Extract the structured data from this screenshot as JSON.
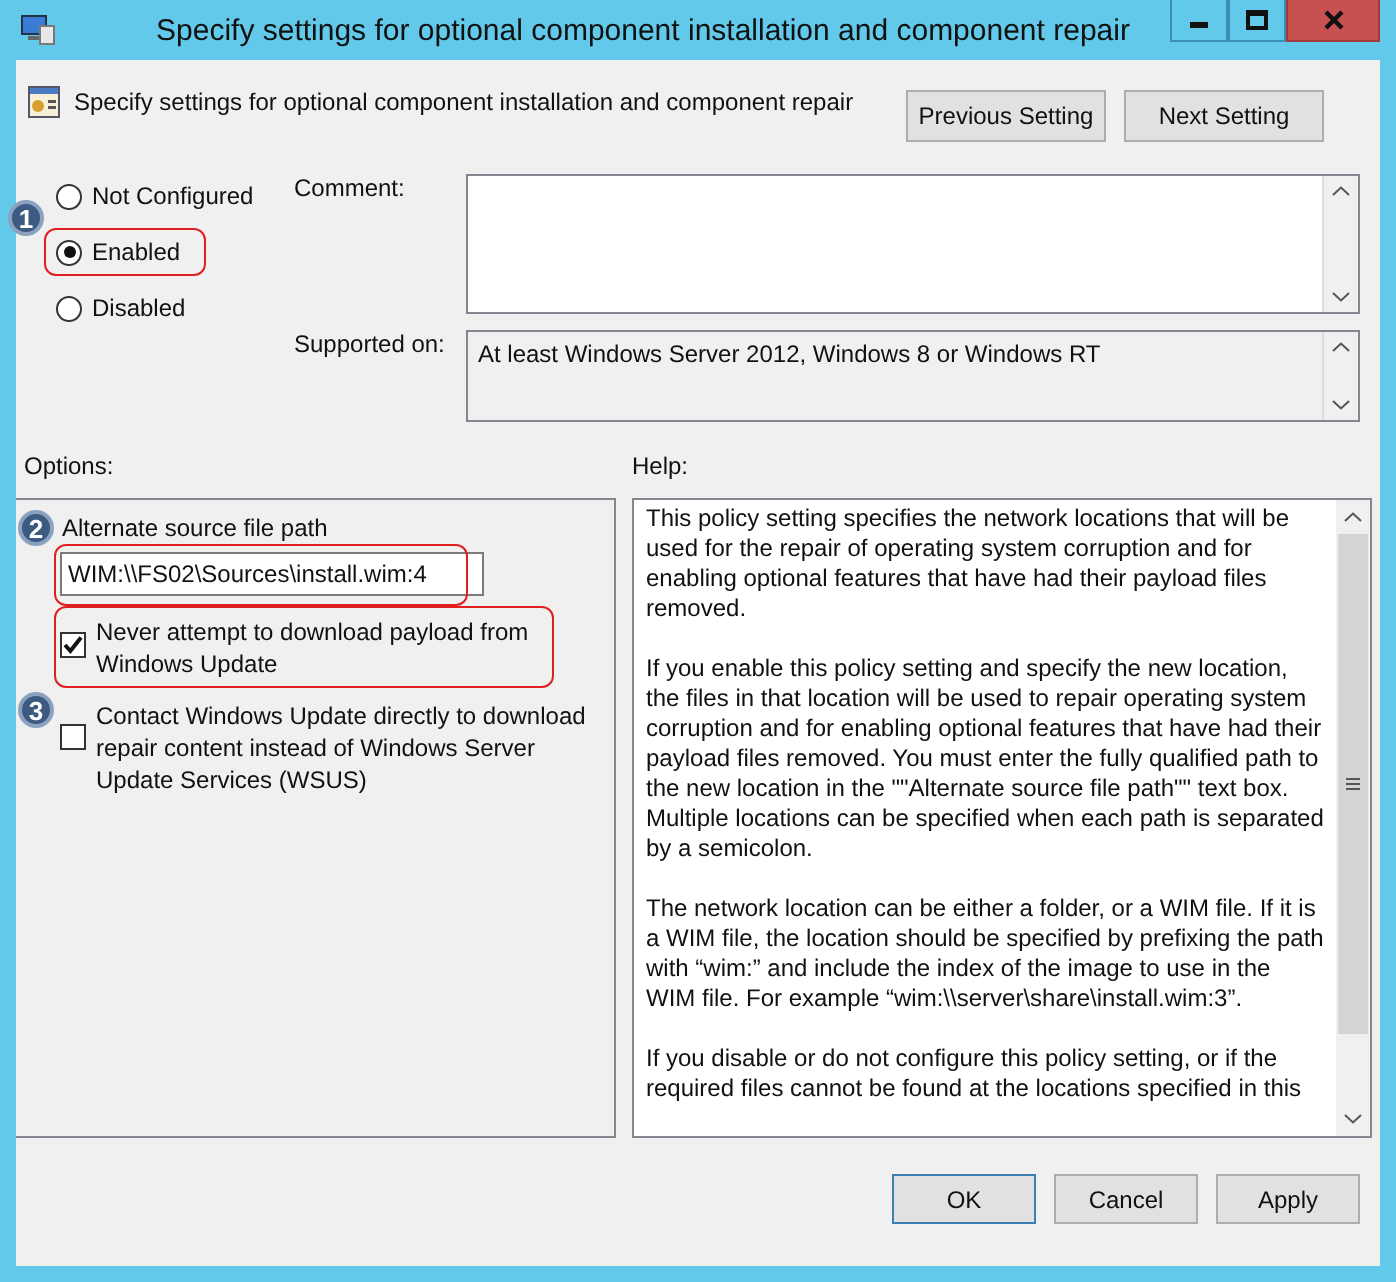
{
  "window": {
    "title": "Specify settings for optional component installation and component repair"
  },
  "header": {
    "title": "Specify settings for optional component installation and component repair",
    "buttons": [
      "Previous Setting",
      "Next Setting"
    ]
  },
  "states": [
    {
      "label": "Not Configured",
      "selected": false,
      "highlighted": false,
      "callout": "1"
    },
    {
      "label": "Enabled",
      "selected": true,
      "highlighted": true
    },
    {
      "label": "Disabled",
      "selected": false,
      "highlighted": false
    }
  ],
  "comment": {
    "label": "Comment:"
  },
  "supported": {
    "label": "Supported on:",
    "value": "At least Windows Server 2012, Windows 8 or Windows RT"
  },
  "options_label": "Options:",
  "help_label": "Help:",
  "options": [
    {
      "kind": "text",
      "label": "Alternate source file path",
      "value": "WIM:\\\\FS02\\Sources\\install.wim:4",
      "highlighted": true,
      "callout": "2"
    },
    {
      "kind": "checkbox",
      "label": "Never attempt to download payload from Windows Update",
      "checked": true,
      "highlighted": true
    },
    {
      "kind": "checkbox",
      "label": "Contact Windows Update directly to download repair content instead of Windows Server Update Services (WSUS)",
      "checked": false,
      "highlighted": false,
      "callout": "3"
    }
  ],
  "help": [
    "This policy setting specifies the network locations that will be used for the repair of operating system corruption and for enabling optional features that have had their payload files removed.",
    "If you enable this policy setting and specify the new location, the files in that location will be used to repair operating system corruption and for enabling optional features that have had their payload files removed. You must enter the fully qualified path to the new location in the \"\"Alternate source file path\"\" text box. Multiple locations can be specified when each path is separated by a semicolon.",
    "The network location can be either a folder, or a WIM file. If it is a WIM file, the location should be specified by prefixing the path with “wim:” and include the index of the image to use in the WIM file. For example “wim:\\\\server\\share\\install.wim:3”.",
    "If you disable or do not configure this policy setting, or if the required files cannot be found at the locations specified in this"
  ],
  "footer": {
    "buttons": [
      {
        "label": "OK",
        "default": true
      },
      {
        "label": "Cancel",
        "default": false
      },
      {
        "label": "Apply",
        "default": false
      }
    ]
  }
}
